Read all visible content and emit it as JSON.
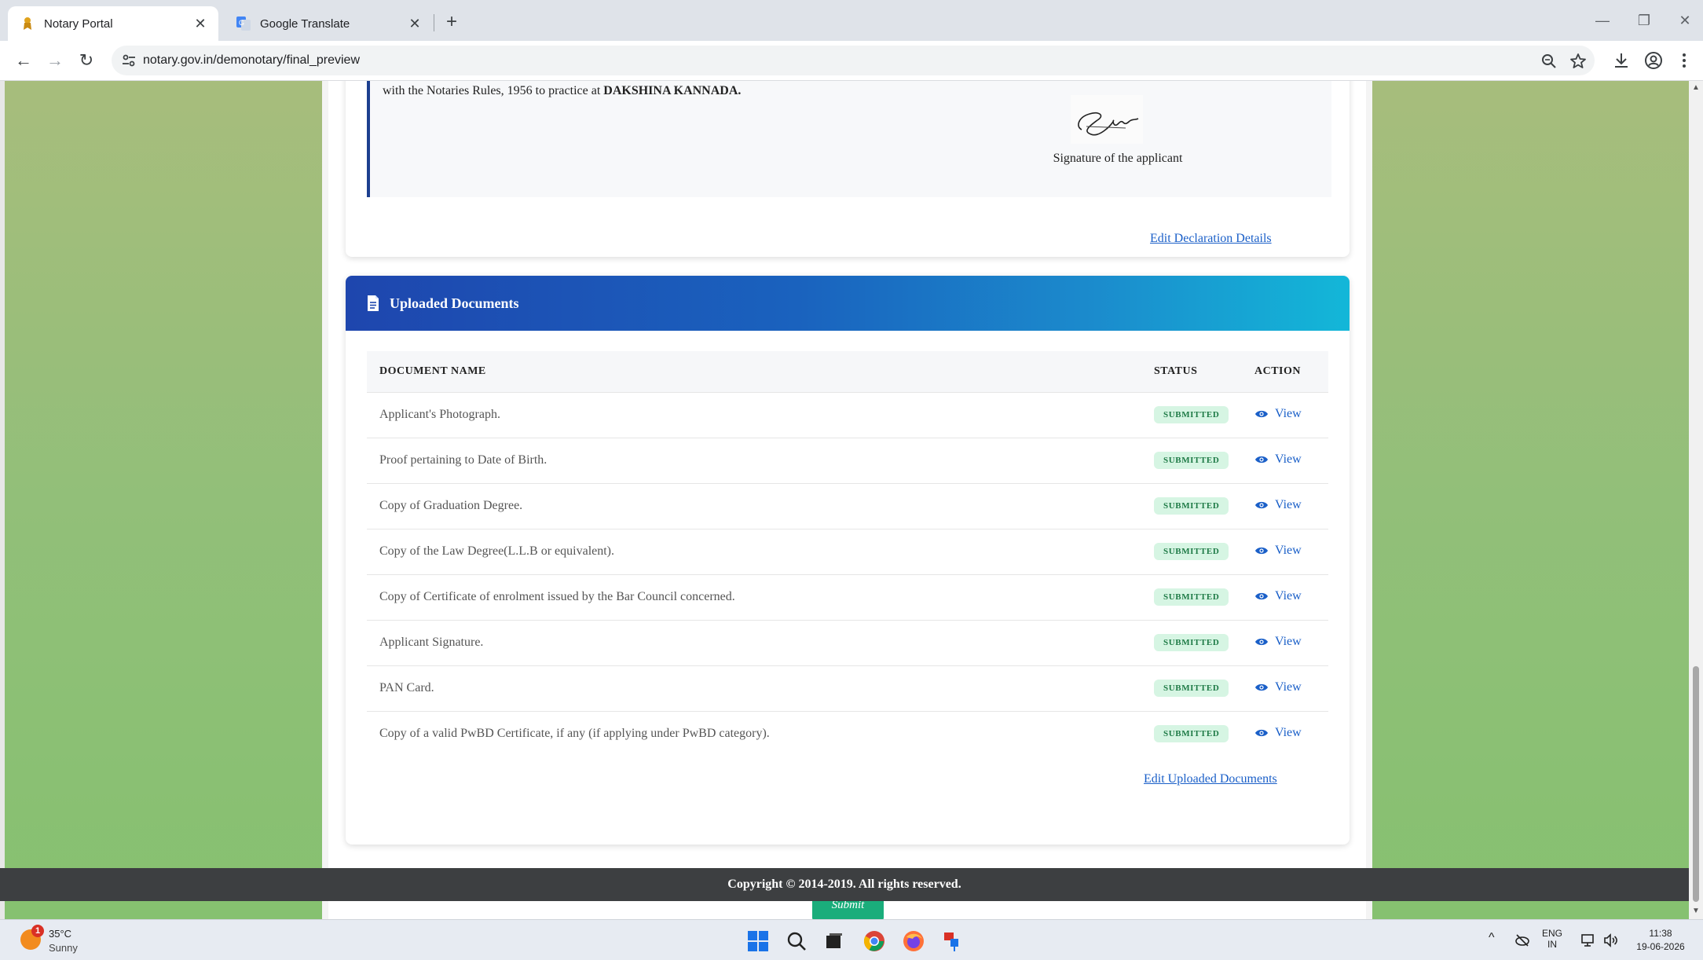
{
  "browser": {
    "tabs": [
      {
        "title": "Notary Portal",
        "active": true
      },
      {
        "title": "Google Translate",
        "active": false
      }
    ],
    "url": "notary.gov.in/demonotary/final_preview"
  },
  "declaration": {
    "text_prefix": "with the Notaries Rules, 1956 to practice at ",
    "text_place": "DAKSHINA KANNADA.",
    "signature_label": "Signature of the applicant",
    "edit_link": "Edit Declaration Details"
  },
  "documents": {
    "heading": "Uploaded Documents",
    "columns": {
      "name": "DOCUMENT NAME",
      "status": "STATUS",
      "action": "ACTION"
    },
    "rows": [
      {
        "name": "Applicant's Photograph.",
        "status": "SUBMITTED",
        "action": "View"
      },
      {
        "name": "Proof pertaining to Date of Birth.",
        "status": "SUBMITTED",
        "action": "View"
      },
      {
        "name": "Copy of Graduation Degree.",
        "status": "SUBMITTED",
        "action": "View"
      },
      {
        "name": "Copy of the Law Degree(L.L.B or equivalent).",
        "status": "SUBMITTED",
        "action": "View"
      },
      {
        "name": "Copy of Certificate of enrolment issued by the Bar Council concerned.",
        "status": "SUBMITTED",
        "action": "View"
      },
      {
        "name": "Applicant Signature.",
        "status": "SUBMITTED",
        "action": "View"
      },
      {
        "name": "PAN Card.",
        "status": "SUBMITTED",
        "action": "View"
      },
      {
        "name": "Copy of a valid PwBD Certificate, if any (if applying under PwBD category).",
        "status": "SUBMITTED",
        "action": "View"
      }
    ],
    "edit_link": "Edit Uploaded Documents"
  },
  "submit_label": "Submit",
  "footer": "Copyright © 2014-2019. All rights reserved.",
  "taskbar": {
    "weather": {
      "temp": "35°C",
      "condition": "Sunny",
      "badge": "1"
    },
    "lang": {
      "line1": "ENG",
      "line2": "IN"
    },
    "time": "11:38",
    "date": "19-06-2026"
  },
  "colors": {
    "header_gradient_start": "#1e46ae",
    "header_gradient_end": "#13b7d8",
    "submit": "#1aad7b",
    "badge_bg": "#d6f5e3",
    "badge_text": "#1e7a46",
    "link": "#1a5fc8",
    "footer_bg": "#3d3f41"
  }
}
